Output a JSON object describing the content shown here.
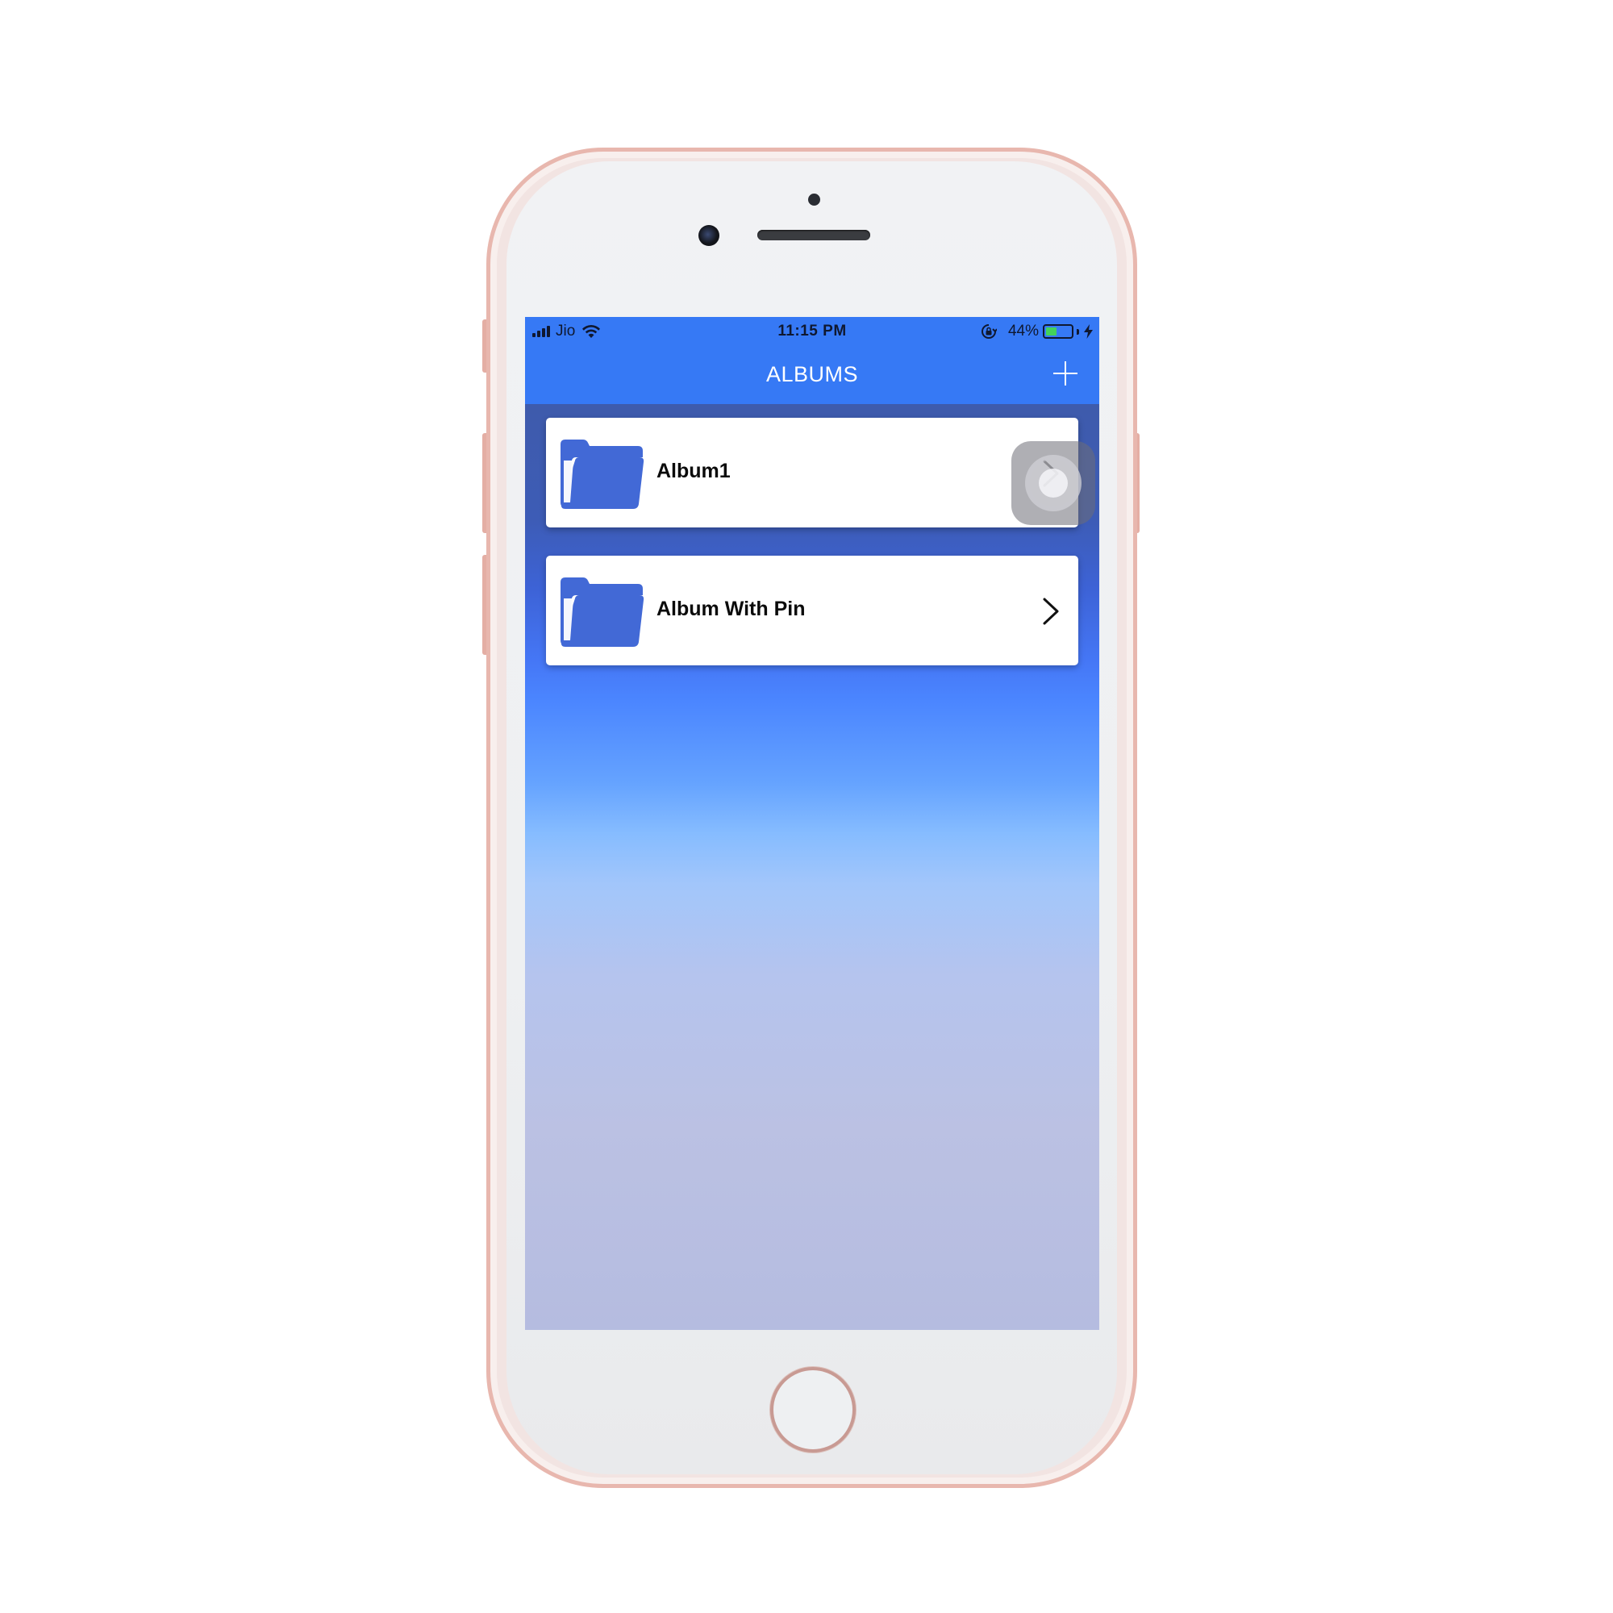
{
  "status_bar": {
    "carrier": "Jio",
    "time": "11:15 PM",
    "battery_percent": "44%",
    "battery_level": 0.44
  },
  "nav": {
    "title": "ALBUMS",
    "add_icon": "plus-icon"
  },
  "albums": [
    {
      "name": "Album1",
      "icon": "folder-icon",
      "accessory": "chevron-right-icon"
    },
    {
      "name": "Album With Pin",
      "icon": "folder-icon",
      "accessory": "chevron-right-icon"
    }
  ],
  "colors": {
    "accent": "#3679f5",
    "folder": "#4269d6",
    "phone_frame": "#e8b7ae"
  }
}
